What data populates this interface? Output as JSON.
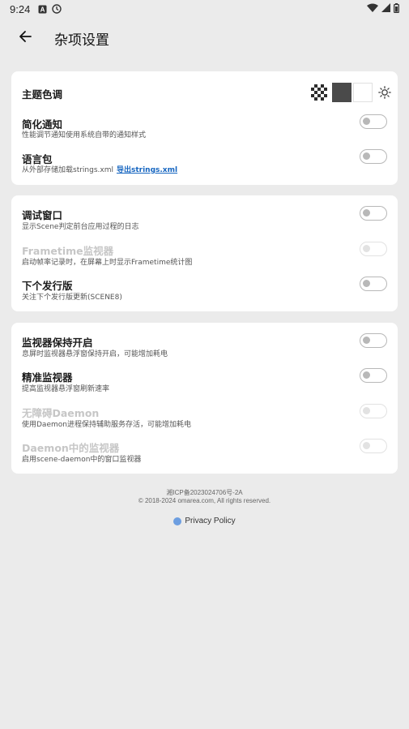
{
  "status_bar": {
    "time": "9:24",
    "left_icons": [
      "a-icon",
      "clock-icon"
    ],
    "right_icons": [
      "wifi-icon",
      "signal-icon",
      "battery-icon"
    ]
  },
  "app_bar": {
    "title": "杂项设置",
    "back_icon": "arrow-left-icon"
  },
  "theme": {
    "label": "主题色调",
    "swatches": [
      "checker",
      "#4a4a4a",
      "#ffffff"
    ],
    "brightness_icon": "sun-icon"
  },
  "card1": [
    {
      "title": "简化通知",
      "desc": "性能调节通知使用系统自带的通知样式",
      "enabled": true,
      "on": false
    },
    {
      "title": "语言包",
      "desc": "从外部存储加载strings.xml",
      "link": "导出strings.xml",
      "enabled": true,
      "on": false
    }
  ],
  "card2": [
    {
      "title": "调试窗口",
      "desc": "显示Scene判定前台应用过程的日志",
      "enabled": true,
      "on": false
    },
    {
      "title": "Frametime监视器",
      "desc": "启动帧率记录时，在屏幕上时显示Frametime统计图",
      "enabled": false,
      "on": false
    },
    {
      "title": "下个发行版",
      "desc": "关注下个发行版更新(SCENE8)",
      "enabled": true,
      "on": false
    }
  ],
  "card3": [
    {
      "title": "监视器保持开启",
      "desc": "息屏时监视器悬浮窗保持开启，可能增加耗电",
      "enabled": true,
      "on": false
    },
    {
      "title": "精准监视器",
      "desc": "提高监视器悬浮窗刷新速率",
      "enabled": true,
      "on": false
    },
    {
      "title": "无障碍Daemon",
      "desc": "使用Daemon进程保持辅助服务存活，可能增加耗电",
      "enabled": false,
      "on": false
    },
    {
      "title": "Daemon中的监视器",
      "desc": "启用scene-daemon中的窗口监视器",
      "enabled": false,
      "on": false
    }
  ],
  "footer": {
    "icp": "湘ICP备2023024706号-2A",
    "copyright": "© 2018-2024 omarea.com, All rights reserved.",
    "privacy": "Privacy Policy"
  },
  "colors": {
    "background": "#ebebeb",
    "card": "#ffffff",
    "link": "#1565c0",
    "privacy_dot": "#6d9ee0"
  }
}
